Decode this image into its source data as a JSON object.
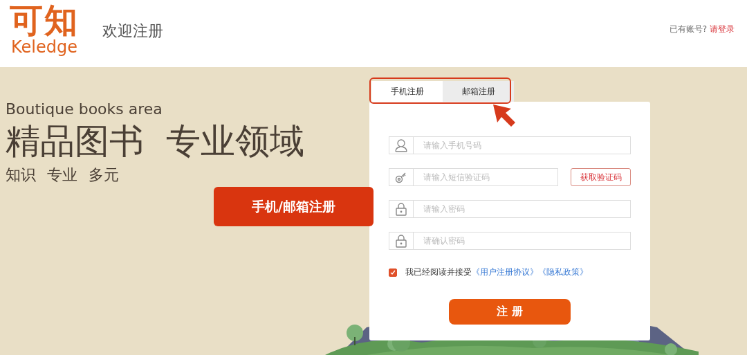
{
  "header": {
    "logo_cn": "可知",
    "logo_en": "Keledge",
    "title": "欢迎注册",
    "login_prompt": "已有账号?",
    "login_link": "请登录"
  },
  "hero": {
    "subtitle": "Boutique books area",
    "headline": [
      "精品图书",
      "专业领域"
    ],
    "tags": [
      "知识",
      "专业",
      "多元"
    ]
  },
  "callout_button": "手机/邮箱注册",
  "tabs": [
    {
      "label": "手机注册",
      "selected": true
    },
    {
      "label": "邮箱注册",
      "selected": false
    }
  ],
  "fields": [
    {
      "kind": "user",
      "placeholder": "请输入手机号码"
    },
    {
      "kind": "key",
      "placeholder": "请输入短信验证码",
      "action": "获取验证码"
    },
    {
      "kind": "lock",
      "placeholder": "请输入密码"
    },
    {
      "kind": "lock",
      "placeholder": "请确认密码"
    }
  ],
  "agreement": {
    "checked": true,
    "text": "我已经阅读并接受",
    "links": [
      "《用户注册协议》",
      "《隐私政策》"
    ]
  },
  "submit": "注 册"
}
